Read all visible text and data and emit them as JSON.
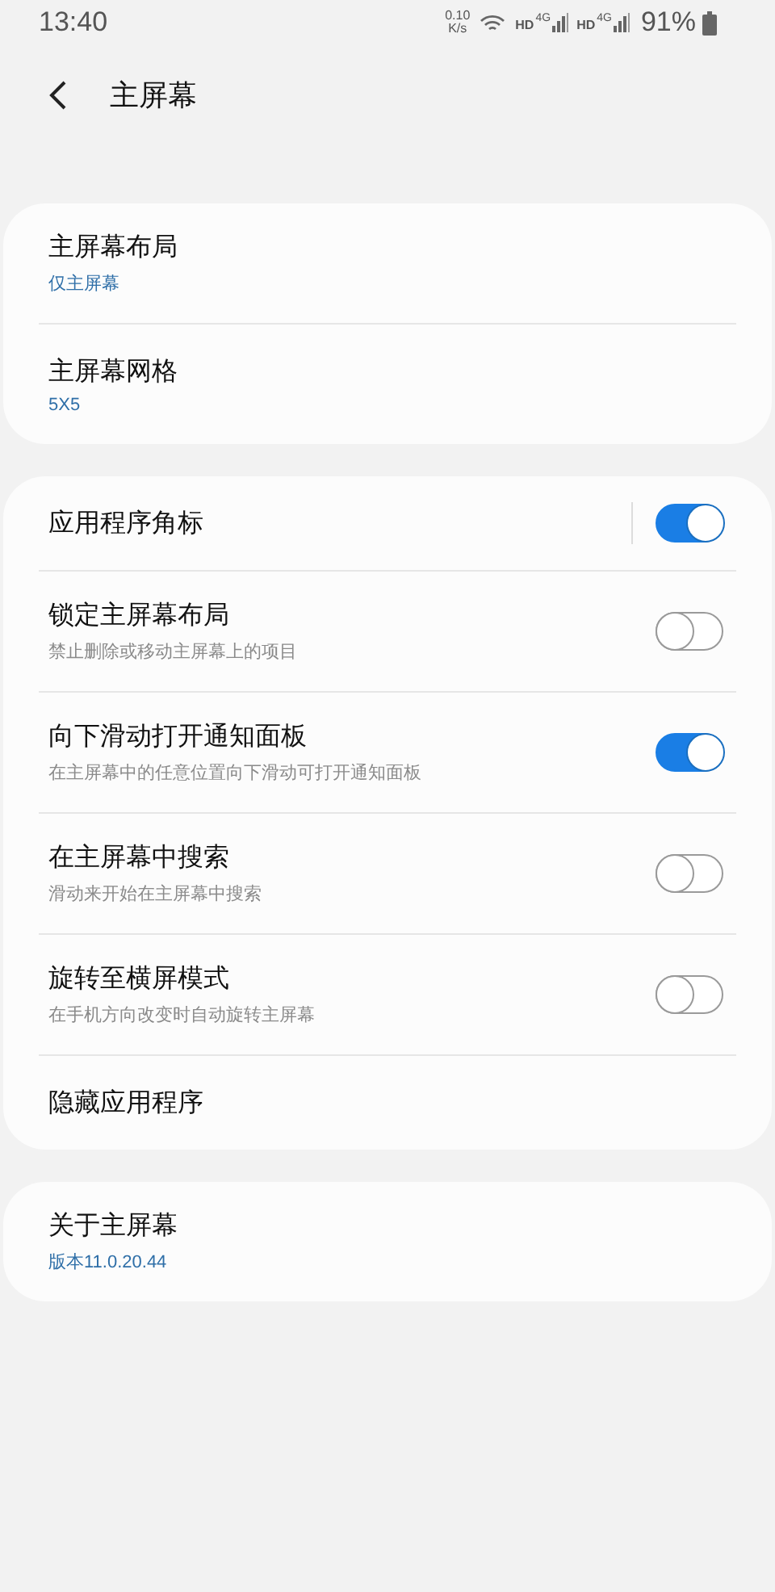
{
  "status_bar": {
    "time": "13:40",
    "net_speed": "0.10",
    "net_unit": "K/s",
    "sims": [
      {
        "hd": "HD",
        "network": "4G"
      },
      {
        "hd": "HD",
        "network": "4G"
      }
    ],
    "battery": "91%"
  },
  "header": {
    "title": "主屏幕"
  },
  "groups": [
    {
      "items": [
        {
          "kind": "link",
          "title": "主屏幕布局",
          "value": "仅主屏幕"
        },
        {
          "kind": "link",
          "title": "主屏幕网格",
          "value": "5X5"
        }
      ]
    },
    {
      "items": [
        {
          "kind": "split-toggle",
          "title": "应用程序角标",
          "on": true
        },
        {
          "kind": "toggle",
          "title": "锁定主屏幕布局",
          "description": "禁止删除或移动主屏幕上的项目",
          "on": false
        },
        {
          "kind": "toggle",
          "title": "向下滑动打开通知面板",
          "description": "在主屏幕中的任意位置向下滑动可打开通知面板",
          "on": true
        },
        {
          "kind": "toggle",
          "title": "在主屏幕中搜索",
          "description": "滑动来开始在主屏幕中搜索",
          "on": false
        },
        {
          "kind": "toggle",
          "title": "旋转至横屏模式",
          "description": "在手机方向改变时自动旋转主屏幕",
          "on": false
        },
        {
          "kind": "link",
          "title": "隐藏应用程序"
        }
      ]
    },
    {
      "items": [
        {
          "kind": "link",
          "title": "关于主屏幕",
          "value": "版本11.0.20.44"
        }
      ]
    }
  ]
}
